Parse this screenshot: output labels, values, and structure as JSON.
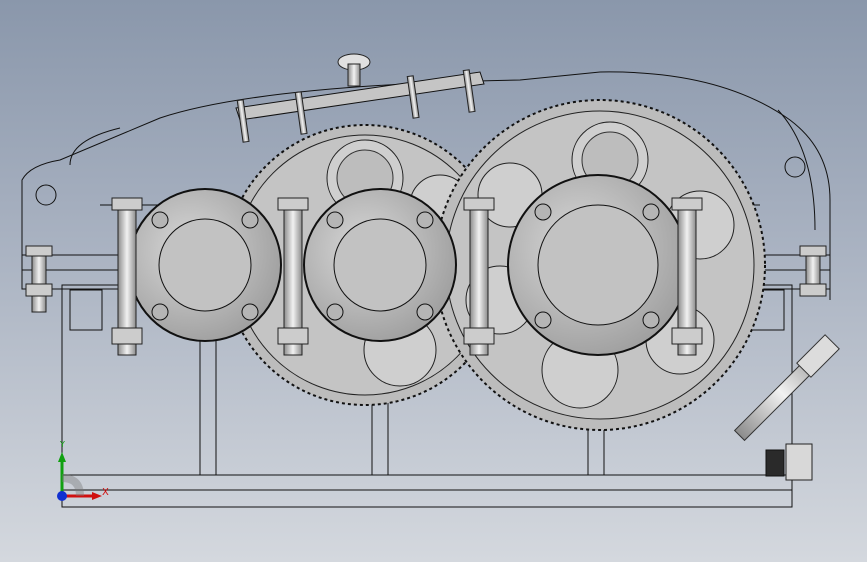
{
  "viewport": {
    "background_top": "#8a97ab",
    "background_bottom": "#d4d8de"
  },
  "model": {
    "type": "gear-reducer-assembly-front-view",
    "parts": [
      "housing",
      "cover",
      "inspection-cover",
      "vent-cap",
      "gear-large-1",
      "gear-large-2",
      "bearing-cap-left",
      "bearing-cap-middle",
      "bearing-cap-right",
      "bolts",
      "oil-dipstick",
      "drain-plug"
    ]
  },
  "triad": {
    "x_label": "X",
    "y_label": "Y",
    "x_color": "#d01010",
    "y_color": "#10a010",
    "z_color": "#1030d0"
  },
  "colors": {
    "line": "#111111",
    "metal": "#c9c9c9",
    "metal_dark": "#9a9a9a",
    "face": "#b8b8b8"
  }
}
